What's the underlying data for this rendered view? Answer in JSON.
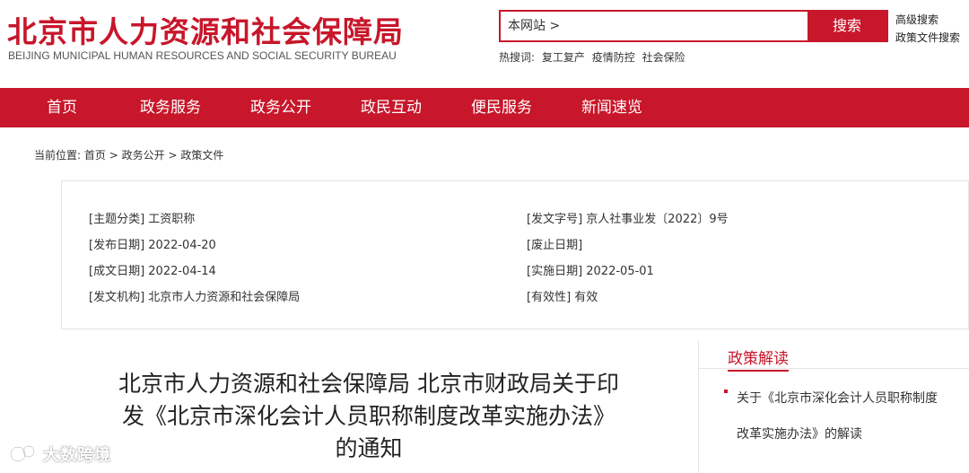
{
  "header": {
    "logo_cn": "北京市人力资源和社会保障局",
    "logo_en": "BEIJING MUNICIPAL HUMAN RESOURCES AND SOCIAL SECURITY BUREAU",
    "search_scope": "本网站 >",
    "search_button": "搜索",
    "advanced_search": "高级搜索",
    "policy_search": "政策文件搜索",
    "hot_label": "热搜词:",
    "hot_words": [
      "复工复产",
      "疫情防控",
      "社会保险"
    ]
  },
  "nav": {
    "items": [
      "首页",
      "政务服务",
      "政务公开",
      "政民互动",
      "便民服务",
      "新闻速览"
    ]
  },
  "breadcrumb": {
    "label": "当前位置:",
    "items": [
      "首页",
      "政务公开",
      "政策文件"
    ],
    "separator": ">"
  },
  "info": {
    "topic": "[主题分类]  工资职称",
    "issue_date": "[发布日期]  2022-04-20",
    "draft_date": "[成文日期]  2022-04-14",
    "issuer": "[发文机构]  北京市人力资源和社会保障局",
    "doc_no": "[发文字号]  京人社事业发〔2022〕9号",
    "abolish_date": "[废止日期]",
    "effective_date": "[实施日期]  2022-05-01",
    "validity": "[有效性]  有效"
  },
  "document": {
    "title_line1": "北京市人力资源和社会保障局 北京市财政局关于印",
    "title_line2": "发《北京市深化会计人员职称制度改革实施办法》",
    "title_line3": "的通知"
  },
  "sidebar": {
    "title": "政策解读",
    "link_line1": "关于《北京市深化会计人员职称制度",
    "link_line2": "改革实施办法》的解读"
  },
  "watermark": {
    "text": "大数跨境"
  },
  "colors": {
    "brand_red": "#c8162a"
  }
}
